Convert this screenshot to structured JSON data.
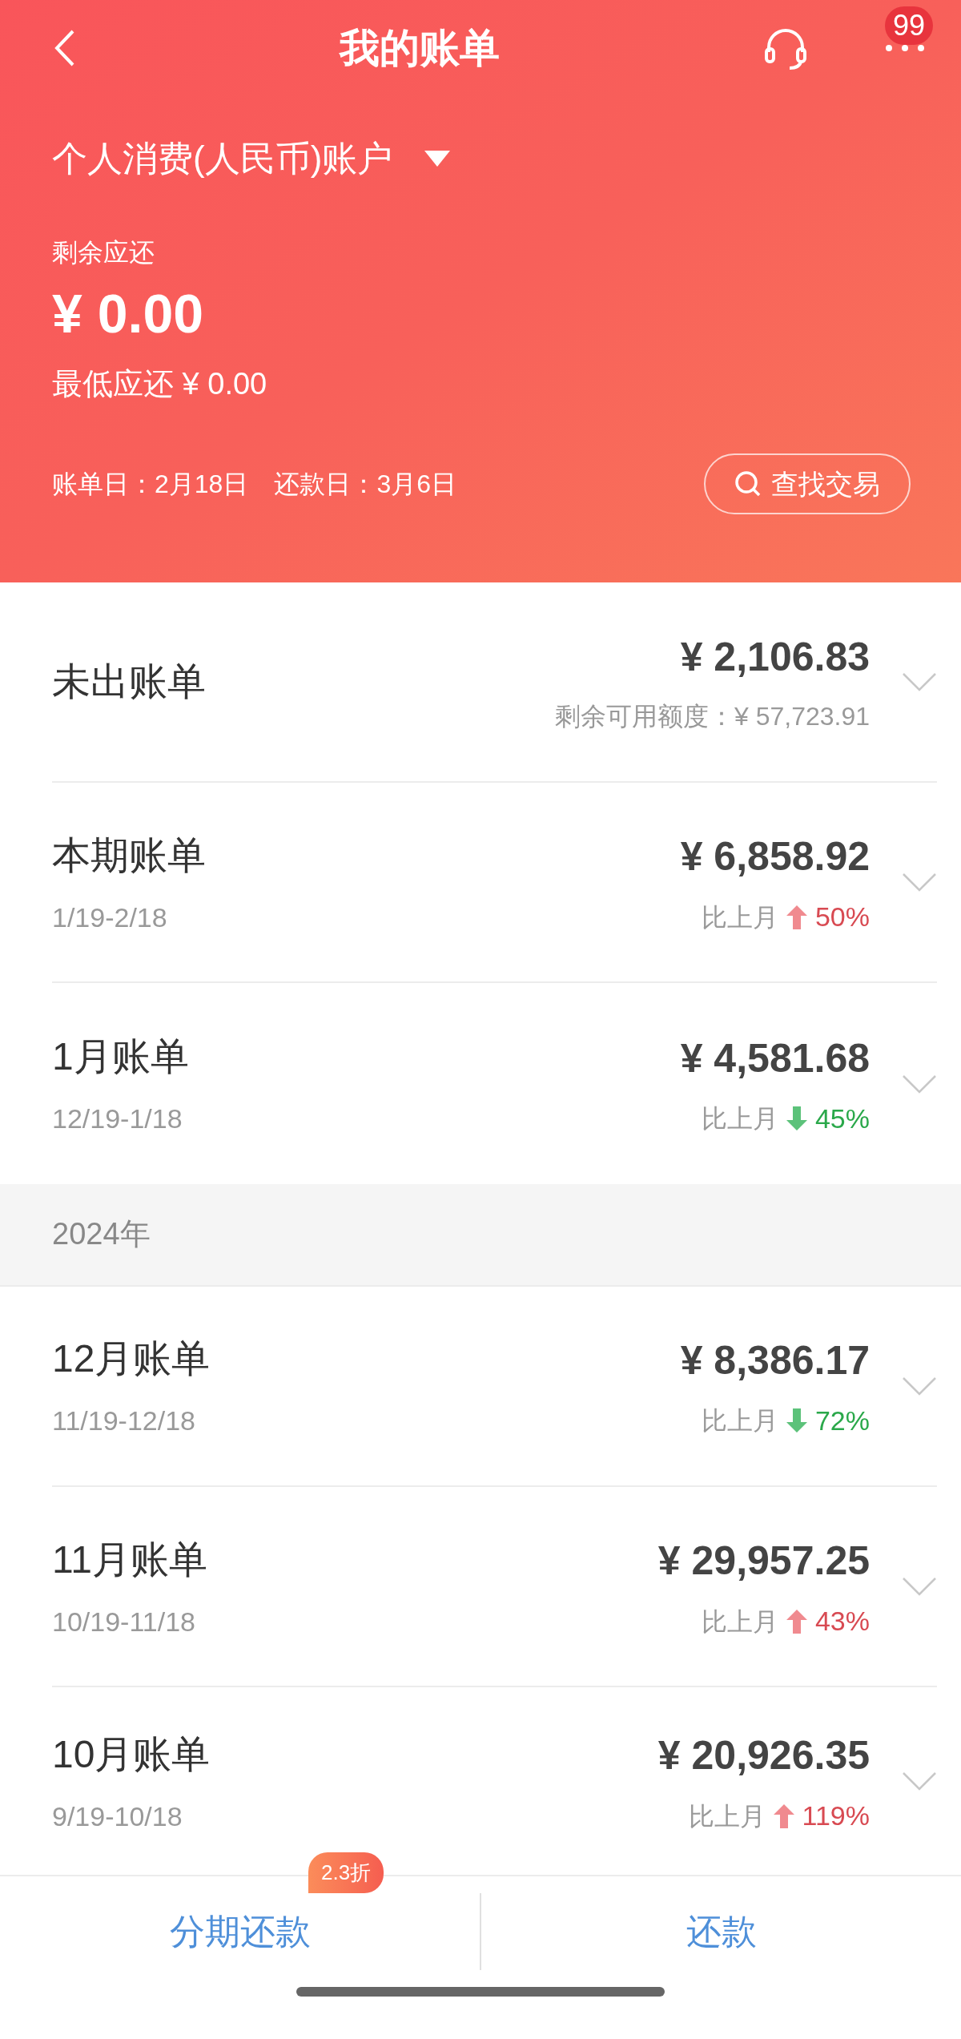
{
  "header": {
    "title": "我的账单",
    "badge": "99",
    "account": "个人消费(人民币)账户",
    "remaining_label": "剩余应还",
    "remaining_amount": "¥ 0.00",
    "minimum": "最低应还 ¥ 0.00",
    "statement_date": "账单日：2月18日",
    "due_date": "还款日：3月6日",
    "search_button": "查找交易"
  },
  "sections": [
    {
      "rows": [
        {
          "title": "未出账单",
          "amount": "¥ 2,106.83",
          "subtitle": "剩余可用额度：¥ 57,723.91",
          "kind": "pending"
        },
        {
          "title": "本期账单",
          "period": "1/19-2/18",
          "amount": "¥ 6,858.92",
          "compare_label": "比上月",
          "change": "50%",
          "kind": "up"
        },
        {
          "title": "1月账单",
          "period": "12/19-1/18",
          "amount": "¥ 4,581.68",
          "compare_label": "比上月",
          "change": "45%",
          "kind": "down"
        }
      ]
    },
    {
      "year": "2024年",
      "rows": [
        {
          "title": "12月账单",
          "period": "11/19-12/18",
          "amount": "¥ 8,386.17",
          "compare_label": "比上月",
          "change": "72%",
          "kind": "down"
        },
        {
          "title": "11月账单",
          "period": "10/19-11/18",
          "amount": "¥ 29,957.25",
          "compare_label": "比上月",
          "change": "43%",
          "kind": "up"
        },
        {
          "title": "10月账单",
          "period": "9/19-10/18",
          "amount": "¥ 20,926.35",
          "compare_label": "比上月",
          "change": "119%",
          "kind": "up"
        }
      ]
    }
  ],
  "bottom_bar": {
    "installment_button": "分期还款",
    "installment_badge": "2.3折",
    "repay_button": "还款"
  }
}
